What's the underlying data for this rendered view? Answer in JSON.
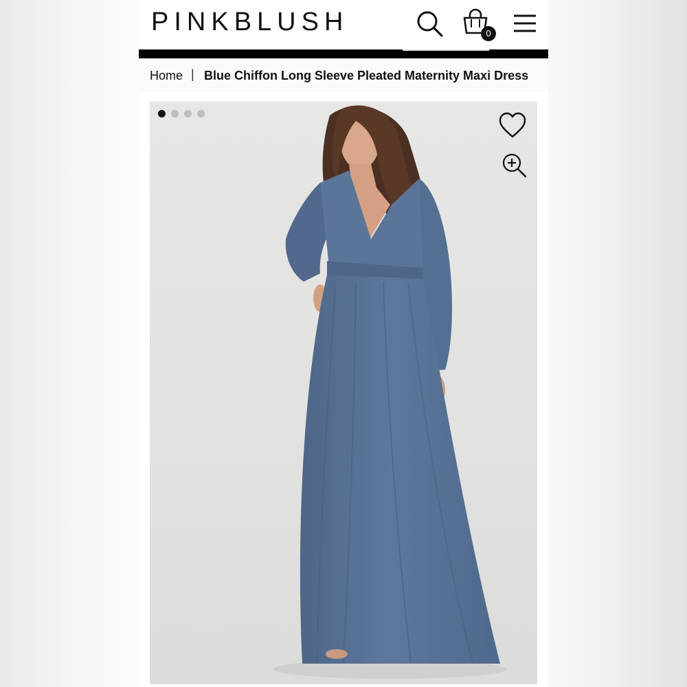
{
  "header": {
    "logo": "PINKBLUSH",
    "cart_count": "0",
    "icons": {
      "search": "search-icon",
      "cart": "shopping-bag-icon",
      "menu": "hamburger-menu-icon",
      "favorite": "heart-icon",
      "zoom": "zoom-in-icon"
    }
  },
  "breadcrumb": {
    "home": "Home",
    "separator": "|",
    "current": "Blue Chiffon Long Sleeve Pleated Maternity Maxi Dress"
  },
  "gallery": {
    "slides": 4,
    "active_slide": 1
  },
  "colors": {
    "dress": "#5c7699",
    "bar": "#000000",
    "background": "#e3e3e1"
  }
}
